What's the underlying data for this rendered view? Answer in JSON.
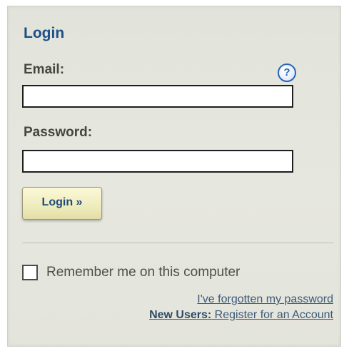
{
  "login": {
    "title": "Login",
    "email_label": "Email:",
    "email_value": "",
    "password_label": "Password:",
    "password_value": "",
    "help_icon": "?",
    "submit_label": "Login »",
    "remember_label": "Remember me on this computer",
    "remember_checked": false,
    "forgot_link": "I've forgotten my password",
    "new_users_label": "New Users:",
    "register_link": " Register for an Account"
  },
  "colors": {
    "title": "#1d4f86",
    "panel_bg": "#e3e4dc",
    "button_bg": "#f0edc0",
    "link": "#3c5a77"
  },
  "icons": {
    "help": "help-question-icon"
  }
}
